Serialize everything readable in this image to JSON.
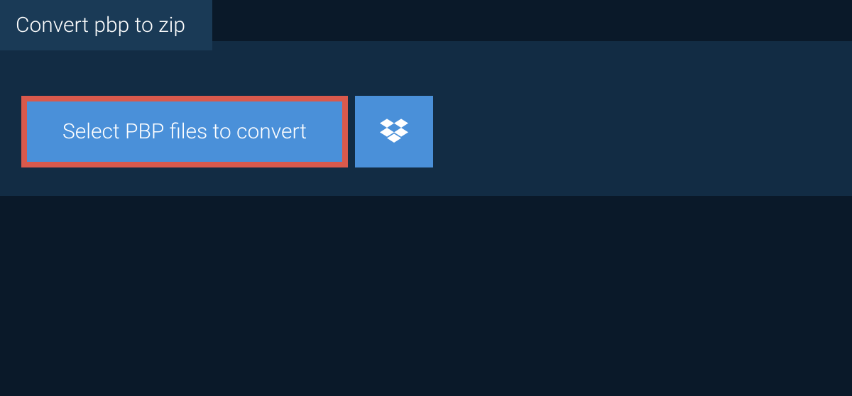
{
  "tab": {
    "title": "Convert pbp to zip"
  },
  "buttons": {
    "select_label": "Select PBP files to convert"
  },
  "colors": {
    "background": "#0a1929",
    "panel": "#122c44",
    "tab": "#1a3a56",
    "button": "#4a90d9",
    "button_border": "#d9594c"
  }
}
